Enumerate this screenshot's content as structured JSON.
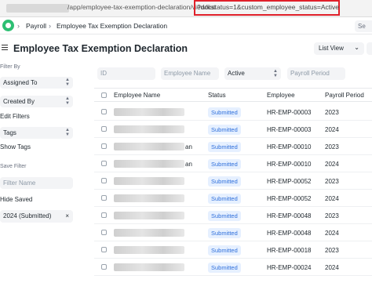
{
  "browser": {
    "url_path": "/app/employee-tax-exemption-declaration/view/list",
    "url_query": "?docstatus=1&custom_employee_status=Active"
  },
  "navbar": {
    "breadcrumbs": [
      "Payroll",
      "Employee Tax Exemption Declaration"
    ],
    "search_placeholder": "Se"
  },
  "page": {
    "title": "Employee Tax Exemption Declaration",
    "view_switcher": "List View"
  },
  "sidebar": {
    "filter_by_label": "Filter By",
    "assigned_to": "Assigned To",
    "created_by": "Created By",
    "edit_filters": "Edit Filters",
    "tags": "Tags",
    "show_tags": "Show Tags",
    "save_filter_label": "Save Filter",
    "filter_name_placeholder": "Filter Name",
    "hide_saved": "Hide Saved",
    "saved_filter": "2024 (Submitted)",
    "saved_filter_close": "×"
  },
  "filters": {
    "id_placeholder": "ID",
    "employee_name_placeholder": "Employee Name",
    "status_value": "Active",
    "payroll_period_placeholder": "Payroll Period"
  },
  "table": {
    "columns": [
      "Employee Name",
      "Status",
      "Employee",
      "Payroll Period"
    ],
    "rows": [
      {
        "name_suffix": "",
        "status": "Submitted",
        "employee": "HR-EMP-00003",
        "period": "2023"
      },
      {
        "name_suffix": "",
        "status": "Submitted",
        "employee": "HR-EMP-00003",
        "period": "2024"
      },
      {
        "name_suffix": "an",
        "status": "Submitted",
        "employee": "HR-EMP-00010",
        "period": "2023"
      },
      {
        "name_suffix": "an",
        "status": "Submitted",
        "employee": "HR-EMP-00010",
        "period": "2024"
      },
      {
        "name_suffix": "",
        "status": "Submitted",
        "employee": "HR-EMP-00052",
        "period": "2023"
      },
      {
        "name_suffix": "",
        "status": "Submitted",
        "employee": "HR-EMP-00052",
        "period": "2024"
      },
      {
        "name_suffix": "",
        "status": "Submitted",
        "employee": "HR-EMP-00048",
        "period": "2023"
      },
      {
        "name_suffix": "",
        "status": "Submitted",
        "employee": "HR-EMP-00048",
        "period": "2024"
      },
      {
        "name_suffix": "",
        "status": "Submitted",
        "employee": "HR-EMP-00018",
        "period": "2023"
      },
      {
        "name_suffix": "",
        "status": "Submitted",
        "employee": "HR-EMP-00024",
        "period": "2024"
      }
    ]
  },
  "colors": {
    "highlight_border": "#e0202a",
    "badge_bg": "#e6f0ff",
    "badge_text": "#2f6fdb",
    "logo": "#2dbf73"
  }
}
